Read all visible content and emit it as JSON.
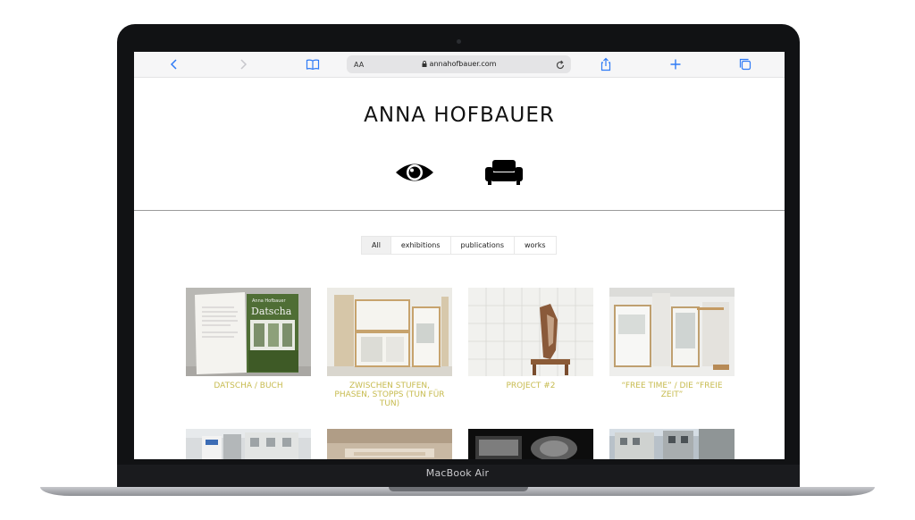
{
  "browser": {
    "text_size_label": "AA",
    "url": "annahofbauer.com"
  },
  "site": {
    "title": "ANNA HOFBAUER",
    "hero_icons": [
      "eye-icon",
      "sofa-icon"
    ]
  },
  "filters": [
    {
      "label": "All",
      "active": true
    },
    {
      "label": "exhibitions",
      "active": false
    },
    {
      "label": "publications",
      "active": false
    },
    {
      "label": "works",
      "active": false
    }
  ],
  "works": [
    {
      "title": "DATSCHA / BUCH"
    },
    {
      "title": "ZWISCHEN STUFEN, PHASEN, STOPPS (TUN FÜR TUN)"
    },
    {
      "title": "PROJECT #2"
    },
    {
      "title": "“FREE TIME” / DIE “FREIE ZEIT”"
    }
  ],
  "device": {
    "label": "MacBook Air"
  },
  "colors": {
    "accent": "#2f7bf6",
    "caption": "#c7bb4f",
    "frame": "#111214"
  }
}
